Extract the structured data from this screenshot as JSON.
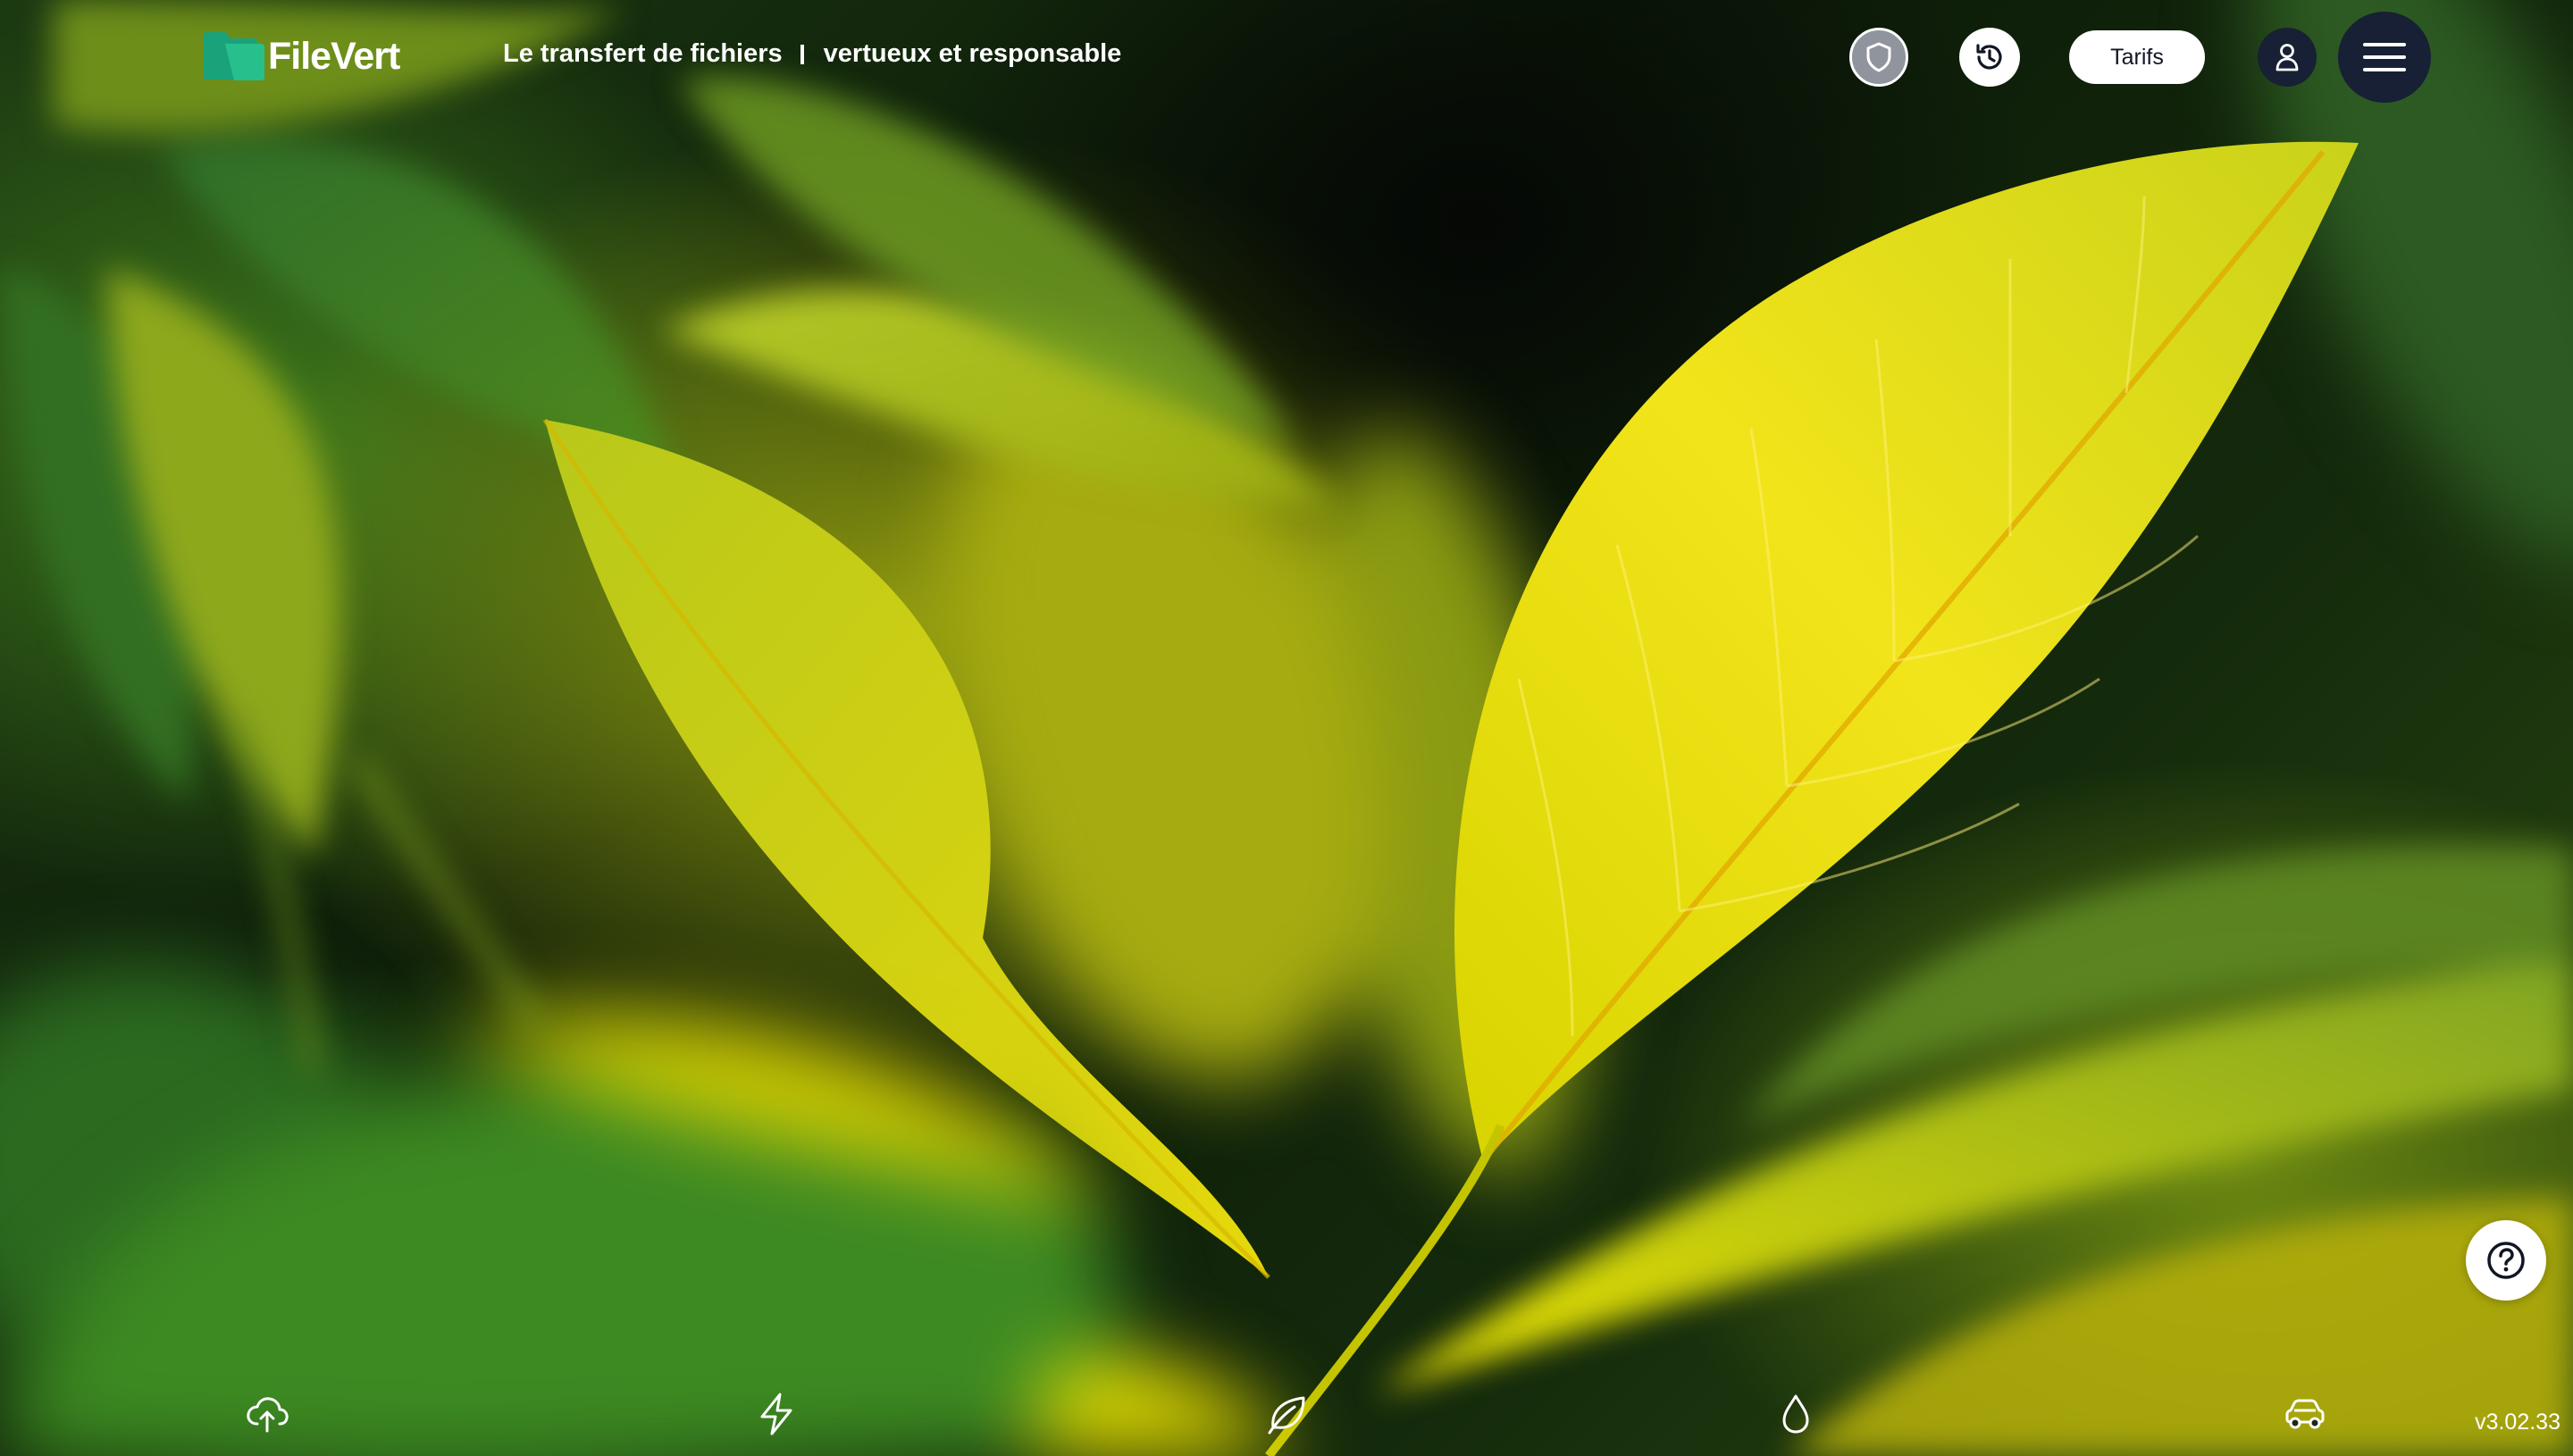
{
  "app": {
    "brand_name": "FileVert",
    "tagline_part1": "Le transfert de fichiers",
    "tagline_part2": "vertueux et responsable"
  },
  "header": {
    "icons": {
      "privacy": "shield-icon",
      "history": "history-clock-icon",
      "account": "user-icon",
      "menu": "hamburger-menu-icon"
    },
    "pricing_label": "Tarifs"
  },
  "help": {
    "icon": "question-circle-icon"
  },
  "bottom_bar": {
    "items": [
      {
        "icon": "cloud-upload-icon"
      },
      {
        "icon": "lightning-icon"
      },
      {
        "icon": "leaf-icon"
      },
      {
        "icon": "water-drop-icon"
      },
      {
        "icon": "car-icon"
      }
    ]
  },
  "footer": {
    "version": "v3.02.33"
  },
  "colors": {
    "header_dark_button": "#172034",
    "shield_button": "#8f949d",
    "logo_teal": "#1aa37a",
    "white": "#ffffff"
  }
}
